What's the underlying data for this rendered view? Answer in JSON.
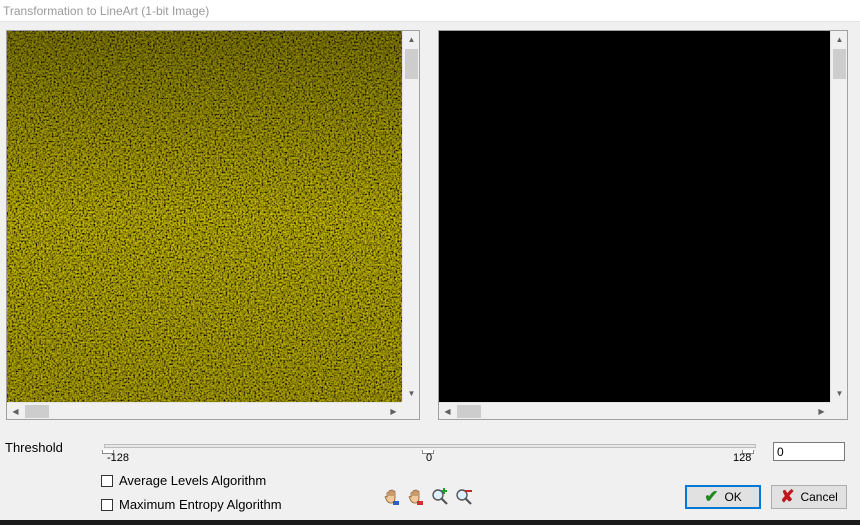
{
  "window": {
    "title": "Transformation to LineArt (1-bit Image)"
  },
  "threshold": {
    "label": "Threshold",
    "min_label": "-128",
    "mid_label": "0",
    "max_label": "128",
    "value": "0"
  },
  "options": {
    "average_levels": {
      "label": "Average Levels Algorithm",
      "checked": false
    },
    "max_entropy": {
      "label": "Maximum Entropy Algorithm",
      "checked": false
    }
  },
  "toolbar": {
    "icons": [
      "pan-hand-icon",
      "pan-hand-alt-icon",
      "zoom-in-icon",
      "zoom-out-icon"
    ]
  },
  "buttons": {
    "ok_label": "OK",
    "cancel_label": "Cancel"
  },
  "colors": {
    "source_image": "#b8a300",
    "lineart_fg": "#ffffff",
    "lineart_bg": "#000000",
    "ok_accent": "#0078d7"
  }
}
